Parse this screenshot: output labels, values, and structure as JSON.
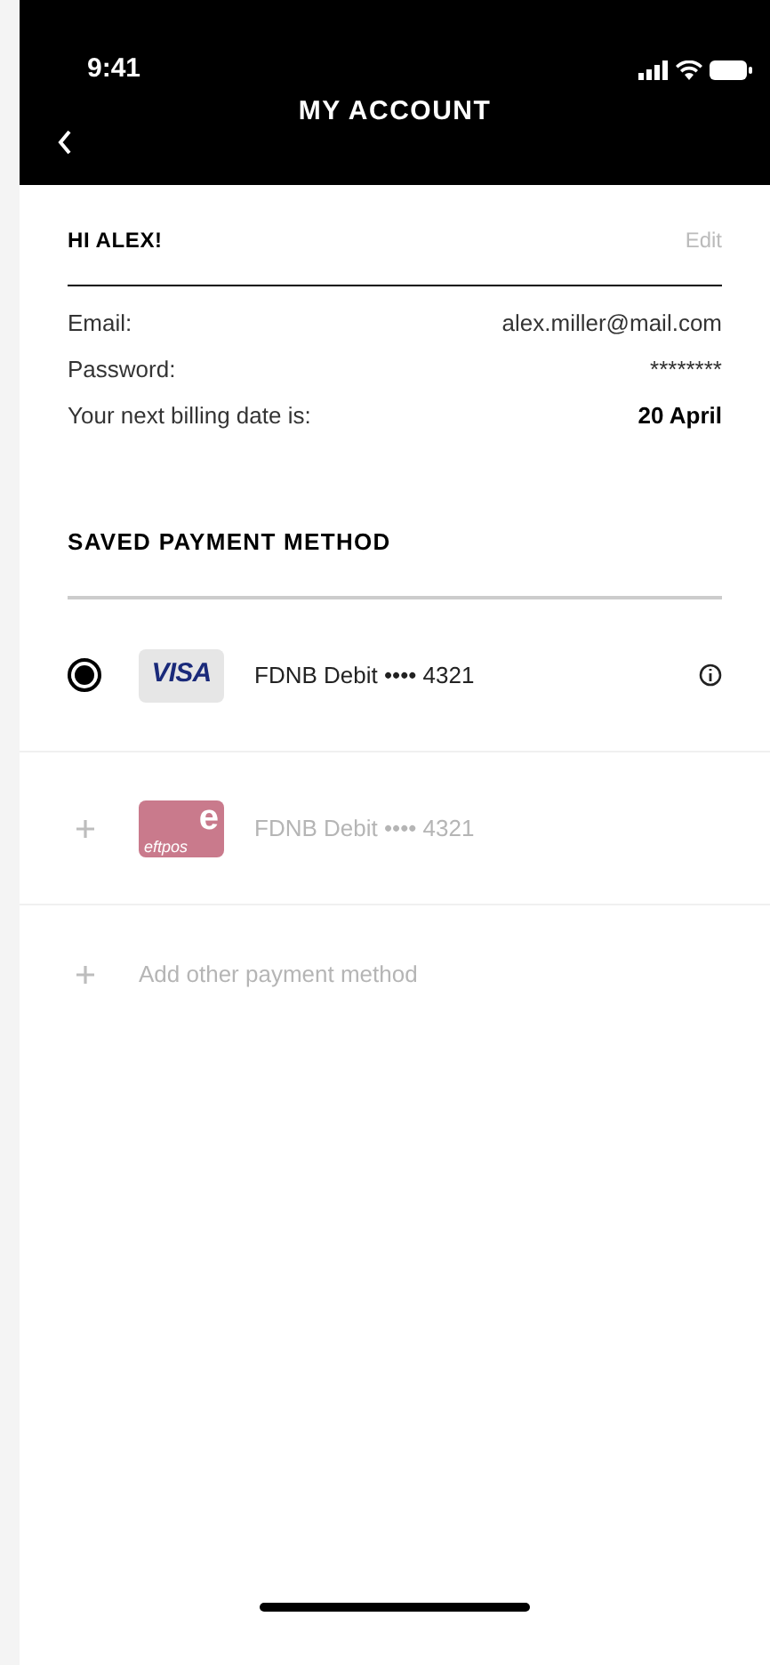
{
  "status_bar": {
    "time": "9:41"
  },
  "header": {
    "title": "MY ACCOUNT"
  },
  "profile": {
    "greeting": "HI ALEX!",
    "edit": "Edit",
    "fields": [
      {
        "label": "Email:",
        "value": "alex.miller@mail.com",
        "emphasis": false
      },
      {
        "label": "Password:",
        "value": "********",
        "emphasis": false
      },
      {
        "label": "Your next billing date is:",
        "value": "20 April",
        "emphasis": true
      }
    ]
  },
  "payment": {
    "heading": "SAVED PAYMENT METHOD",
    "methods": [
      {
        "kind": "visa",
        "logo_text": "VISA",
        "name": "FDNB Debit •••• 4321",
        "selected": true
      },
      {
        "kind": "eftpos",
        "logo_letter": "e",
        "logo_text": "eftpos",
        "name": "FDNB Debit •••• 4321",
        "selected": false
      },
      {
        "kind": "add",
        "name": "Add other payment method"
      }
    ]
  }
}
